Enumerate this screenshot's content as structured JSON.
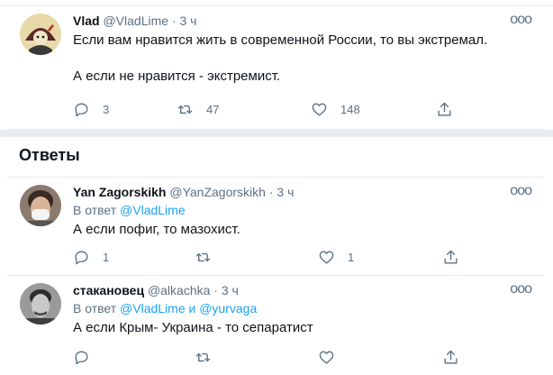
{
  "tweet": {
    "name": "Vlad",
    "handle": "@VladLime",
    "sep": "·",
    "time": "3 ч",
    "text_line1": "Если вам нравится жить в современной России, то вы экстремал.",
    "text_line2": "А если не нравится - экстремист.",
    "replies": "3",
    "retweets": "47",
    "likes": "148",
    "more": "ooo"
  },
  "section": {
    "title": "Ответы"
  },
  "replies": [
    {
      "name": "Yan Zagorskikh",
      "handle": "@YanZagorskikh",
      "sep": "·",
      "time": "3 ч",
      "reply_prefix": "В ответ",
      "reply_to_1": "@VladLime",
      "text": "А если пофиг, то мазохист.",
      "replies": "1",
      "retweets": "",
      "likes": "1",
      "more": "ooo"
    },
    {
      "name": "стакановец",
      "handle": "@alkachka",
      "sep": "·",
      "time": "3 ч",
      "reply_prefix": "В ответ",
      "reply_to_1": "@VladLime",
      "reply_and": "и",
      "reply_to_2": "@yurvaga",
      "text": "А если Крым- Украина - то сепаратист",
      "more": "ooo"
    }
  ],
  "icons": {
    "reply": "reply-icon",
    "retweet": "retweet-icon",
    "like": "heart-icon",
    "share": "share-icon",
    "more": "more-icon"
  },
  "colors": {
    "text": "#0f1419",
    "muted": "#5b7083",
    "link": "#1da1f2",
    "divider": "#e6ecf0"
  }
}
